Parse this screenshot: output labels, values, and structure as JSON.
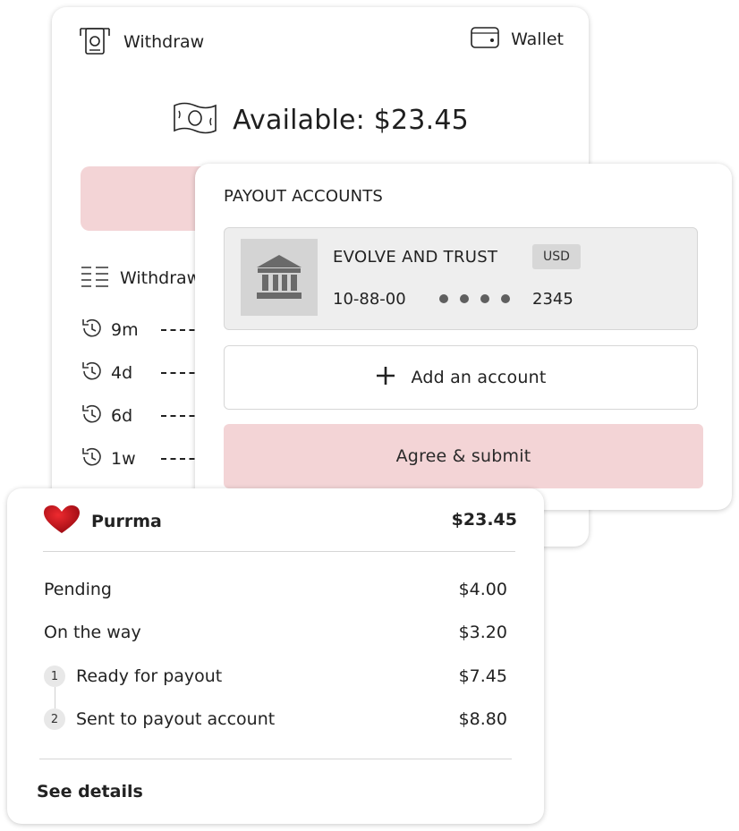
{
  "withdraw": {
    "title": "Withdraw",
    "wallet_label": "Wallet",
    "available": "Available: $23.45",
    "history_title": "Withdraw",
    "history": [
      {
        "time": "9m"
      },
      {
        "time": "4d"
      },
      {
        "time": "6d"
      },
      {
        "time": "1w"
      }
    ]
  },
  "payout": {
    "title": "PAYOUT ACCOUNTS",
    "account": {
      "bank_name": "EVOLVE AND TRUST",
      "currency": "USD",
      "sort_code": "10-88-00",
      "last4": "2345"
    },
    "add_account_label": "Add an account",
    "submit_label": "Agree & submit"
  },
  "summary": {
    "brand": "Purrma",
    "total": "$23.45",
    "rows": [
      {
        "label": "Pending",
        "amount": "$4.00"
      },
      {
        "label": "On the way",
        "amount": "$3.20"
      },
      {
        "step": "1",
        "label": "Ready for payout",
        "amount": "$7.45"
      },
      {
        "step": "2",
        "label": "Sent to payout account",
        "amount": "$8.80"
      }
    ],
    "see_details": "See details"
  },
  "colors": {
    "accent_pink": "#f3d4d6",
    "heart_red": "#c8141e",
    "bank_icon": "#6a6a6a"
  },
  "icons": [
    "atm-withdraw-icon",
    "wallet-icon",
    "cash-icon",
    "list-icon",
    "history-icon",
    "bank-icon",
    "plus-icon",
    "heart-icon"
  ]
}
